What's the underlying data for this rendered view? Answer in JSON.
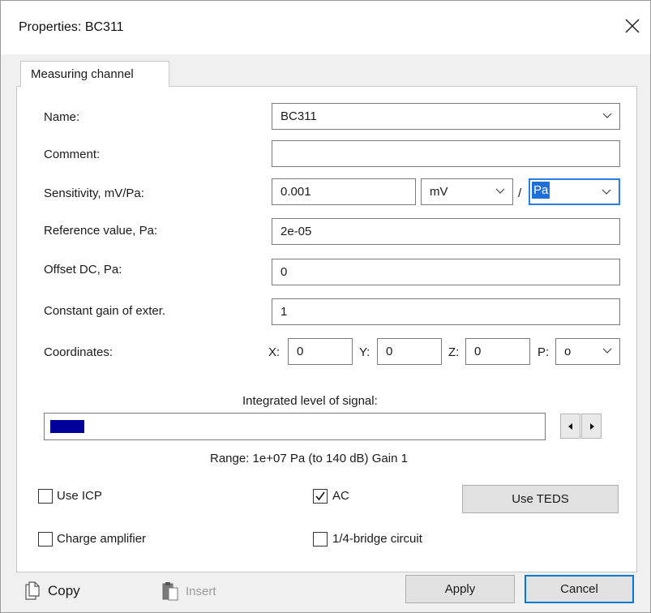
{
  "window": {
    "title": "Properties: BC311"
  },
  "tabs": [
    {
      "label": "Measuring channel"
    }
  ],
  "fields": {
    "name": {
      "label": "Name:",
      "value": "BC311"
    },
    "comment": {
      "label": "Comment:",
      "value": ""
    },
    "sensitivity": {
      "label": "Sensitivity, mV/Pa:",
      "value": "0.001",
      "unit_numerator": "mV",
      "separator": "/",
      "unit_denominator": "Pa"
    },
    "reference": {
      "label": "Reference value, Pa:",
      "value": "2e-05"
    },
    "offset": {
      "label": "Offset DC, Pa:",
      "value": "0"
    },
    "gain": {
      "label": "Constant gain of exter.",
      "value": "1"
    },
    "coordinates": {
      "label": "Coordinates:",
      "x_label": "X:",
      "x": "0",
      "y_label": "Y:",
      "y": "0",
      "z_label": "Z:",
      "z": "0",
      "p_label": "P:",
      "p": "o"
    }
  },
  "signal": {
    "title": "Integrated level of signal:",
    "level_fraction": 0.07,
    "fill_color": "#00009a",
    "range_text": "Range: 1e+07 Pa (to 140 dB) Gain 1"
  },
  "options": {
    "use_icp": {
      "label": "Use ICP",
      "checked": false
    },
    "ac": {
      "label": "AC",
      "checked": true
    },
    "charge_amp": {
      "label": "Charge amplifier",
      "checked": false
    },
    "quarter_bridge": {
      "label": "1/4-bridge circuit",
      "checked": false
    },
    "use_teds": {
      "label": "Use TEDS"
    }
  },
  "footer": {
    "copy_label": "Copy",
    "insert_label": "Insert",
    "apply_label": "Apply",
    "cancel_label": "Cancel"
  },
  "colors": {
    "focus_border": "#2a7de1",
    "selection": "#1e6fd9",
    "default_button_border": "#0078d7"
  }
}
